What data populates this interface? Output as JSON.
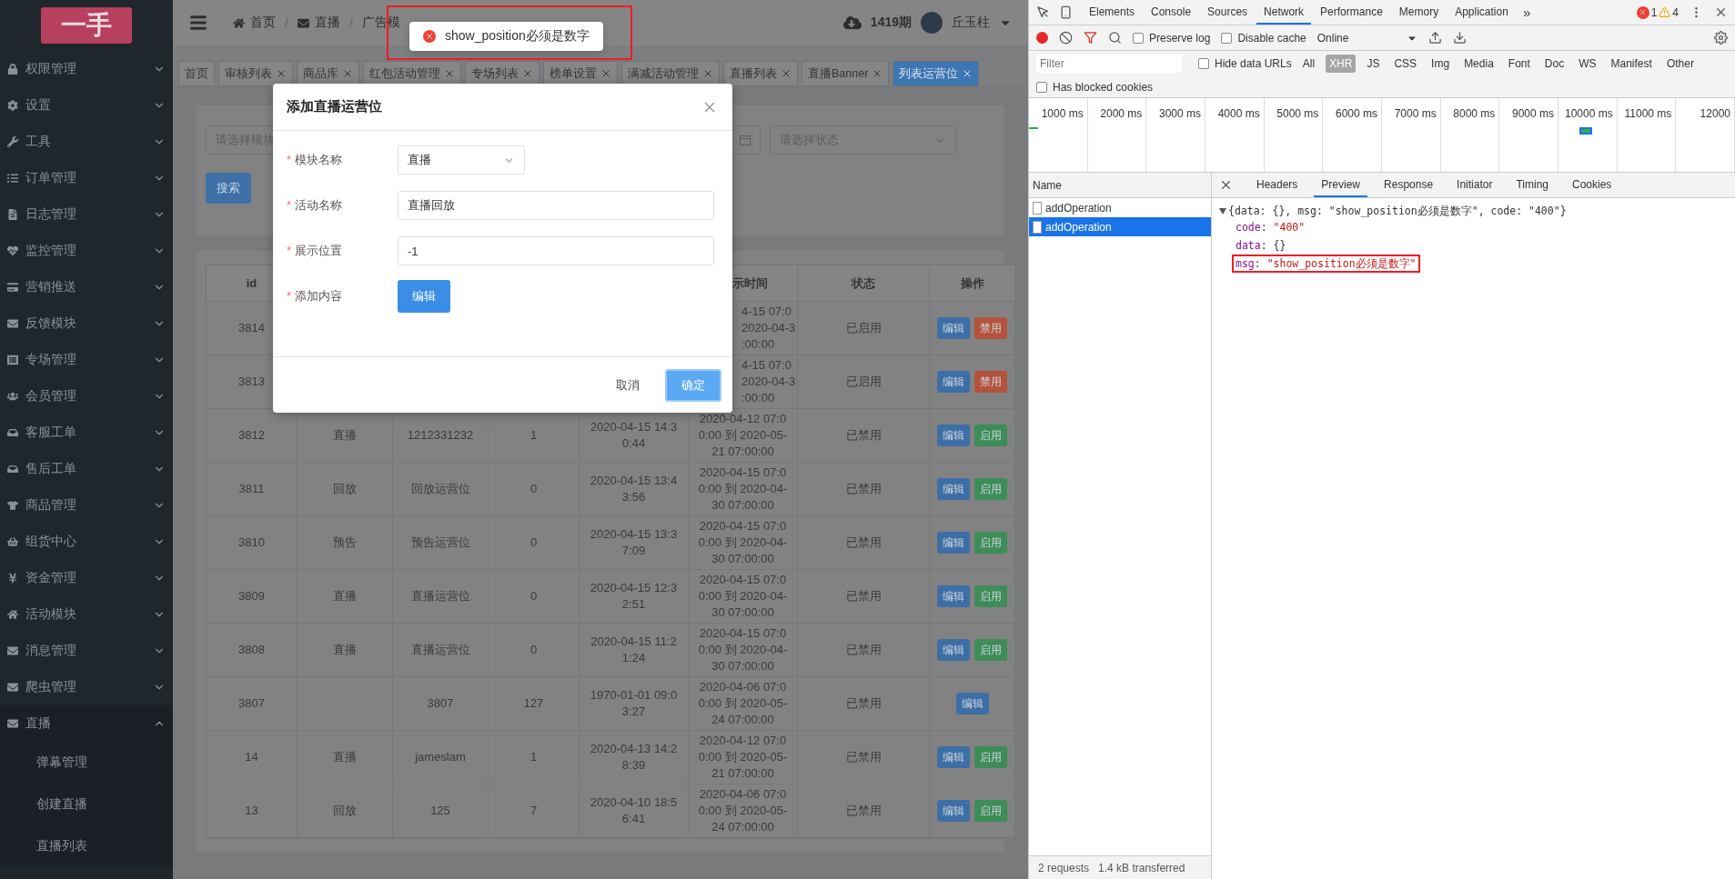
{
  "toast": {
    "message": "show_position必须是数字"
  },
  "sidebar": {
    "logo": "一手",
    "items": [
      {
        "label": "权限管理",
        "expanded": false
      },
      {
        "label": "设置",
        "expanded": false
      },
      {
        "label": "工具",
        "expanded": false
      },
      {
        "label": "订单管理",
        "expanded": false
      },
      {
        "label": "日志管理",
        "expanded": false
      },
      {
        "label": "监控管理",
        "expanded": false
      },
      {
        "label": "营销推送",
        "expanded": false
      },
      {
        "label": "反馈模块",
        "expanded": false
      },
      {
        "label": "专场管理",
        "expanded": false
      },
      {
        "label": "会员管理",
        "expanded": false
      },
      {
        "label": "客服工单",
        "expanded": false
      },
      {
        "label": "售后工单",
        "expanded": false
      },
      {
        "label": "商品管理",
        "expanded": false
      },
      {
        "label": "组货中心",
        "expanded": false
      },
      {
        "label": "资金管理",
        "expanded": false
      },
      {
        "label": "活动模块",
        "expanded": false
      },
      {
        "label": "消息管理",
        "expanded": false
      },
      {
        "label": "爬虫管理",
        "expanded": false
      },
      {
        "label": "直播",
        "expanded": true,
        "children": [
          {
            "label": "弹幕管理"
          },
          {
            "label": "创建直播"
          },
          {
            "label": "直播列表"
          }
        ]
      }
    ]
  },
  "header": {
    "separator": "/",
    "breadcrumb": [
      "首页",
      "直播",
      "广告模"
    ],
    "period": "1419期",
    "user": "丘玉柱"
  },
  "tabs": [
    {
      "label": "首页",
      "selected": false,
      "closable": false
    },
    {
      "label": "审核列表",
      "selected": false,
      "closable": true
    },
    {
      "label": "商品库",
      "selected": false,
      "closable": true
    },
    {
      "label": "红包活动管理",
      "selected": false,
      "closable": true
    },
    {
      "label": "专场列表",
      "selected": false,
      "closable": true
    },
    {
      "label": "榜单设置",
      "selected": false,
      "closable": true
    },
    {
      "label": "满减活动管理",
      "selected": false,
      "closable": true
    },
    {
      "label": "直播列表",
      "selected": false,
      "closable": true
    },
    {
      "label": "直播Banner",
      "selected": false,
      "closable": true
    },
    {
      "label": "列表运营位",
      "selected": true,
      "closable": true
    }
  ],
  "filters": {
    "module_placeholder": "请选择模块",
    "status_placeholder": "请选择状态",
    "search_button": "搜索"
  },
  "table": {
    "columns": [
      {
        "label": "id"
      },
      {},
      {},
      {},
      {},
      {
        "label": "示时间"
      },
      {
        "label": "状态"
      },
      {
        "label": "操作"
      }
    ],
    "rows": [
      {
        "cells": [
          "3814",
          null,
          null,
          null,
          null,
          "4-15 07:0\n2020-04-3\n:00:00",
          "已启用"
        ],
        "actions": [
          {
            "label": "编辑",
            "kind": "edit"
          },
          {
            "label": "禁用",
            "kind": "disable"
          }
        ]
      },
      {
        "cells": [
          "3813",
          null,
          null,
          null,
          null,
          "4-15 07:0\n2020-04-3\n:00:00",
          "已启用"
        ],
        "actions": [
          {
            "label": "编辑",
            "kind": "edit"
          },
          {
            "label": "禁用",
            "kind": "disable"
          }
        ]
      },
      {
        "cells": [
          "3812",
          "直播",
          "1212331232",
          "1",
          "2020-04-15 14:30:44",
          "2020-04-12 07:00:00 到 2020-05-21 07:00:00",
          "已禁用"
        ],
        "actions": [
          {
            "label": "编辑",
            "kind": "edit"
          },
          {
            "label": "启用",
            "kind": "enable"
          }
        ]
      },
      {
        "cells": [
          "3811",
          "回放",
          "回放运营位",
          "0",
          "2020-04-15 13:43:56",
          "2020-04-15 07:00:00 到 2020-04-30 07:00:00",
          "已禁用"
        ],
        "actions": [
          {
            "label": "编辑",
            "kind": "edit"
          },
          {
            "label": "启用",
            "kind": "enable"
          }
        ]
      },
      {
        "cells": [
          "3810",
          "预告",
          "预告运营位",
          "0",
          "2020-04-15 13:37:09",
          "2020-04-15 07:00:00 到 2020-04-30 07:00:00",
          "已禁用"
        ],
        "actions": [
          {
            "label": "编辑",
            "kind": "edit"
          },
          {
            "label": "启用",
            "kind": "enable"
          }
        ]
      },
      {
        "cells": [
          "3809",
          "直播",
          "直播运营位",
          "0",
          "2020-04-15 12:32:51",
          "2020-04-15 07:00:00 到 2020-04-30 07:00:00",
          "已禁用"
        ],
        "actions": [
          {
            "label": "编辑",
            "kind": "edit"
          },
          {
            "label": "启用",
            "kind": "enable"
          }
        ]
      },
      {
        "cells": [
          "3808",
          "直播",
          "直播运营位",
          "0",
          "2020-04-15 11:21:24",
          "2020-04-15 07:00:00 到 2020-04-30 07:00:00",
          "已禁用"
        ],
        "actions": [
          {
            "label": "编辑",
            "kind": "edit"
          },
          {
            "label": "启用",
            "kind": "enable"
          }
        ]
      },
      {
        "cells": [
          "3807",
          null,
          "3807",
          "127",
          "1970-01-01 09:03:27",
          "2020-04-06 07:00:00 到 2020-05-24 07:00:00",
          "已禁用"
        ],
        "actions": [
          {
            "label": "编辑",
            "kind": "edit"
          }
        ]
      },
      {
        "cells": [
          "14",
          "直播",
          "jameslam",
          "1",
          "2020-04-13 14:28:39",
          "2020-04-12 07:00:00 到 2020-05-21 07:00:00",
          "已禁用"
        ],
        "actions": [
          {
            "label": "编辑",
            "kind": "edit"
          },
          {
            "label": "启用",
            "kind": "enable"
          }
        ]
      },
      {
        "cells": [
          "13",
          "回放",
          "125",
          "7",
          "2020-04-10 18:56:41",
          "2020-04-06 07:00:00 到 2020-05-24 07:00:00",
          "已禁用"
        ],
        "actions": [
          {
            "label": "编辑",
            "kind": "edit"
          },
          {
            "label": "启用",
            "kind": "enable"
          }
        ]
      }
    ]
  },
  "dialog": {
    "title": "添加直播运营位",
    "required_mark": "*",
    "fields": [
      {
        "label": "模块名称",
        "required": true,
        "kind": "select",
        "value": "直播"
      },
      {
        "label": "活动名称",
        "required": true,
        "kind": "input",
        "value": "直播回放"
      },
      {
        "label": "展示位置",
        "required": true,
        "kind": "input",
        "value": "-1"
      },
      {
        "label": "添加内容",
        "required": true,
        "kind": "button",
        "value": "编辑"
      }
    ],
    "cancel": "取消",
    "confirm": "确定"
  },
  "devtools": {
    "tabs": [
      {
        "label": "Elements",
        "selected": false
      },
      {
        "label": "Console",
        "selected": false
      },
      {
        "label": "Sources",
        "selected": false
      },
      {
        "label": "Network",
        "selected": true
      },
      {
        "label": "Performance",
        "selected": false
      },
      {
        "label": "Memory",
        "selected": false
      },
      {
        "label": "Application",
        "selected": false
      }
    ],
    "more": "»",
    "errors": "1",
    "warnings": "4",
    "recording": true,
    "options": [
      {
        "label": "Preserve log",
        "checked": false
      },
      {
        "label": "Disable cache",
        "checked": false
      }
    ],
    "throttle": "Online",
    "filter_placeholder": "Filter",
    "hide_data_urls": {
      "label": "Hide data URLs",
      "checked": false
    },
    "types": [
      {
        "label": "All",
        "selected": false
      },
      {
        "label": "XHR",
        "selected": true
      },
      {
        "label": "JS",
        "selected": false
      },
      {
        "label": "CSS",
        "selected": false
      },
      {
        "label": "Img",
        "selected": false
      },
      {
        "label": "Media",
        "selected": false
      },
      {
        "label": "Font",
        "selected": false
      },
      {
        "label": "Doc",
        "selected": false
      },
      {
        "label": "WS",
        "selected": false
      },
      {
        "label": "Manifest",
        "selected": false
      },
      {
        "label": "Other",
        "selected": false
      }
    ],
    "blocked_cookies": {
      "label": "Has blocked cookies",
      "checked": false
    },
    "timeline_ticks": [
      "1000 ms",
      "2000 ms",
      "3000 ms",
      "4000 ms",
      "5000 ms",
      "6000 ms",
      "7000 ms",
      "8000 ms",
      "9000 ms",
      "10000 ms",
      "11000 ms",
      "12000"
    ],
    "name_header": "Name",
    "requests": [
      {
        "name": "addOperation",
        "selected": false
      },
      {
        "name": "addOperation",
        "selected": true
      }
    ],
    "detail_tabs": [
      {
        "label": "Headers",
        "selected": false
      },
      {
        "label": "Preview",
        "selected": true
      },
      {
        "label": "Response",
        "selected": false
      },
      {
        "label": "Initiator",
        "selected": false
      },
      {
        "label": "Timing",
        "selected": false
      },
      {
        "label": "Cookies",
        "selected": false
      }
    ],
    "preview": {
      "separator": ":",
      "summary": "{data: {}, msg: \"show_position必须是数字\", code: \"400\"}",
      "props": [
        {
          "key": "code",
          "value": "\"400\"",
          "kind": "string",
          "highlighted": false
        },
        {
          "key": "data",
          "value": "{}",
          "kind": "object",
          "highlighted": false
        },
        {
          "key": "msg",
          "value": "\"show_position必须是数字\"",
          "kind": "string",
          "highlighted": true
        }
      ]
    },
    "status": [
      "2 requests",
      "1.4 kB transferred"
    ]
  }
}
